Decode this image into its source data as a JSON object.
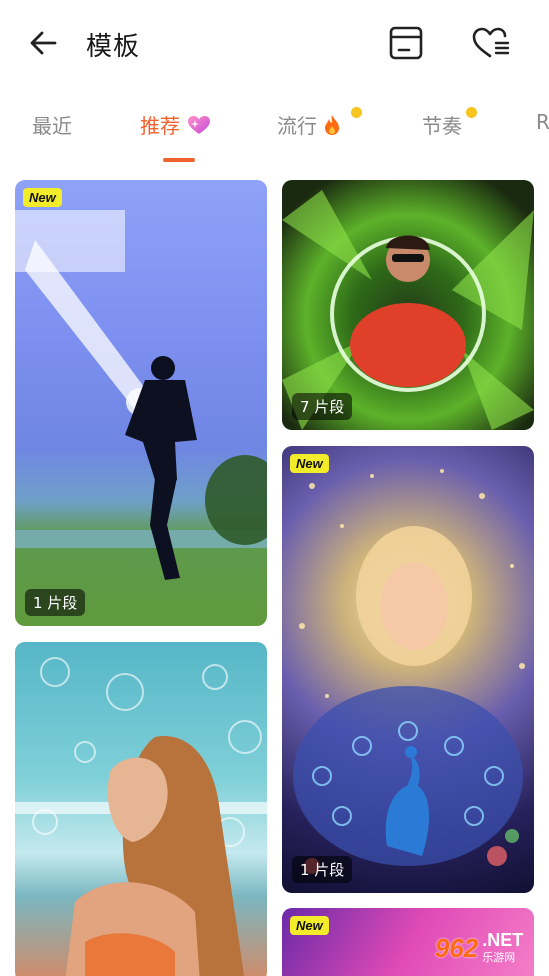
{
  "header": {
    "title": "模板",
    "back_icon": "arrow-left-icon",
    "drafts_icon": "drafts-box-icon",
    "favorites_icon": "heart-list-icon"
  },
  "tabs": [
    {
      "label": "最近",
      "active": false,
      "dot": false,
      "icon": ""
    },
    {
      "label": "推荐",
      "active": true,
      "dot": false,
      "icon": "sparkle-heart-icon"
    },
    {
      "label": "流行",
      "active": false,
      "dot": true,
      "icon": "fire-icon"
    },
    {
      "label": "节奏",
      "active": false,
      "dot": true,
      "icon": ""
    },
    {
      "label": "R",
      "active": false,
      "dot": false,
      "icon": ""
    }
  ],
  "cards": [
    {
      "badge": "New",
      "segments": "1 片段"
    },
    {
      "badge": "",
      "segments": "7 片段"
    },
    {
      "badge": "",
      "segments": ""
    },
    {
      "badge": "New",
      "segments": "1 片段"
    },
    {
      "badge": "New",
      "segments": ""
    }
  ],
  "watermark": {
    "number": "962",
    "suffix": ".NET",
    "sub": "乐游网"
  },
  "colors": {
    "accent": "#f0622d",
    "badge": "#f3ec2a",
    "dot": "#f7c51e"
  }
}
